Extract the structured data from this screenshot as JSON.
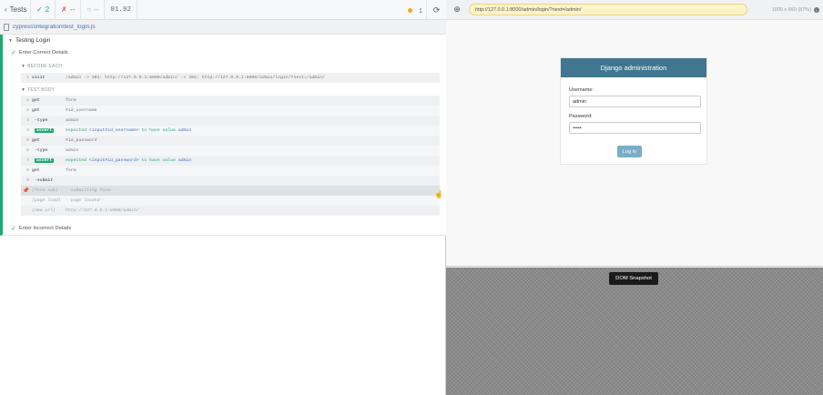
{
  "topbar": {
    "tests_label": "Tests",
    "passed_count": "2",
    "failed_count": "--",
    "pending_count": "--",
    "duration": "01.92"
  },
  "spec": {
    "path": "cypress\\integration\\test_login.js"
  },
  "suite": {
    "title": "Testing Login",
    "test1_title": "Enter Correct Details",
    "test2_title": "Enter Incorrect Details",
    "before_each_label": "BEFORE EACH",
    "test_body_label": "TEST BODY",
    "before_each_cmd": {
      "num": "1",
      "name": "visit",
      "msg": "/admin -> 301: http://127.0.0.1:8000/admin/ -> 302: http://127.0.0.1:8000/admin/login/?next=/admin/"
    },
    "commands": [
      {
        "num": "1",
        "name": "get",
        "msg": "form"
      },
      {
        "num": "2",
        "name": "get",
        "msg": "#id_username"
      },
      {
        "num": "3",
        "name": "-type",
        "msg": "admin"
      },
      {
        "num": "4",
        "badge": "assert",
        "pre": "expected",
        "el": "<input#id_username>",
        "mid": "to have value",
        "val": "admin"
      },
      {
        "num": "5",
        "name": "get",
        "msg": "#id_password"
      },
      {
        "num": "6",
        "name": "-type",
        "msg": "admin"
      },
      {
        "num": "7",
        "badge": "assert",
        "pre": "expected",
        "el": "<input#id_password>",
        "mid": "to have value",
        "val": "admin"
      },
      {
        "num": "8",
        "name": "get",
        "msg": "form"
      },
      {
        "num": "9",
        "name": "-submit",
        "msg": ""
      }
    ],
    "events": [
      {
        "name": "(form sub)",
        "msg": "--submitting form--"
      },
      {
        "name": "(page load)",
        "msg": "--page loaded--"
      },
      {
        "name": "(new url)",
        "msg": "http://127.0.0.1:8000/admin/"
      }
    ]
  },
  "aut": {
    "url": "http://127.0.0.1:8000/admin/login/?next=/admin/",
    "viewport": "1000 x 660  (87%)",
    "django": {
      "header": "Django administration",
      "username_label": "Username:",
      "username_value": "admin",
      "password_label": "Password:",
      "password_value": "•••••",
      "login_button": "Log in"
    },
    "snapshot_label": "DOM Snapshot"
  },
  "colors": {
    "pass": "#1fa971",
    "fail": "#e0424b",
    "django_header": "#417690",
    "django_button": "#79aec8"
  }
}
